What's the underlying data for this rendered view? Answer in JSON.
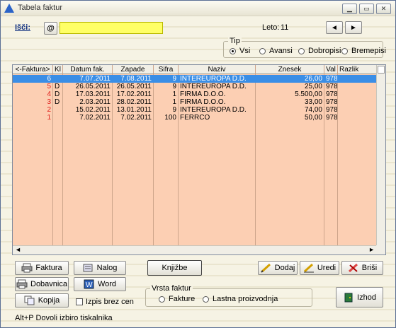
{
  "window": {
    "title": "Tabela faktur"
  },
  "search": {
    "label": "Išči:",
    "at_label": "@",
    "value": ""
  },
  "year": {
    "label": "Leto:",
    "value": "11"
  },
  "nav": {
    "prev": "◄",
    "next": "►"
  },
  "tip": {
    "title": "Tip",
    "options": [
      {
        "label": "Vsi",
        "selected": true
      },
      {
        "label": "Avansi",
        "selected": false
      },
      {
        "label": "Dobropisi",
        "selected": false
      },
      {
        "label": "Bremepisi",
        "selected": false
      }
    ]
  },
  "table": {
    "columns": [
      "<-Faktura>",
      "Kl",
      "Datum fak.",
      "Zapade",
      "Sifra",
      "Naziv",
      "Znesek",
      "Val",
      "Razlik"
    ],
    "rows": [
      {
        "faktura": "6",
        "kl": "",
        "datum": "7.07.2011",
        "zapade": "7.08.2011",
        "sifra": "9",
        "naziv": "INTEREUROPA D.D.",
        "znesek": "26,00",
        "val": "978",
        "selected": true
      },
      {
        "faktura": "5",
        "kl": "D",
        "datum": "26.05.2011",
        "zapade": "26.05.2011",
        "sifra": "9",
        "naziv": "INTEREUROPA D.D.",
        "znesek": "25,00",
        "val": "978",
        "selected": false
      },
      {
        "faktura": "4",
        "kl": "D",
        "datum": "17.03.2011",
        "zapade": "17.02.2011",
        "sifra": "1",
        "naziv": "FIRMA D.O.O.",
        "znesek": "5.500,00",
        "val": "978",
        "selected": false
      },
      {
        "faktura": "3",
        "kl": "D",
        "datum": "2.03.2011",
        "zapade": "28.02.2011",
        "sifra": "1",
        "naziv": "FIRMA D.O.O.",
        "znesek": "33,00",
        "val": "978",
        "selected": false
      },
      {
        "faktura": "2",
        "kl": "",
        "datum": "15.02.2011",
        "zapade": "13.01.2011",
        "sifra": "9",
        "naziv": "INTEREUROPA D.D.",
        "znesek": "74,00",
        "val": "978",
        "selected": false
      },
      {
        "faktura": "1",
        "kl": "",
        "datum": "7.02.2011",
        "zapade": "7.02.2011",
        "sifra": "100",
        "naziv": "FERRCO",
        "znesek": "50,00",
        "val": "978",
        "selected": false
      }
    ]
  },
  "buttons": {
    "faktura": "Faktura",
    "nalog": "Nalog",
    "knjizbe": "Knjižbe",
    "dodaj": "Dodaj",
    "uredi": "Uredi",
    "brisi": "Briši",
    "dobavnica": "Dobavnica",
    "word": "Word",
    "kopija": "Kopija",
    "izhod": "Izhod"
  },
  "print_check": {
    "label": "Izpis brez cen",
    "checked": false
  },
  "vrsta": {
    "title": "Vrsta faktur",
    "options": [
      {
        "label": "Fakture",
        "selected": false
      },
      {
        "label": "Lastna proizvodnja",
        "selected": false
      }
    ]
  },
  "hint": "Alt+P Dovoli izbiro tiskalnika",
  "colors": {
    "grid_bg": "#fccfb3",
    "selected_row": "#3a8ee6",
    "faktura_red": "#e0201c",
    "search_bg": "#ffff66"
  }
}
